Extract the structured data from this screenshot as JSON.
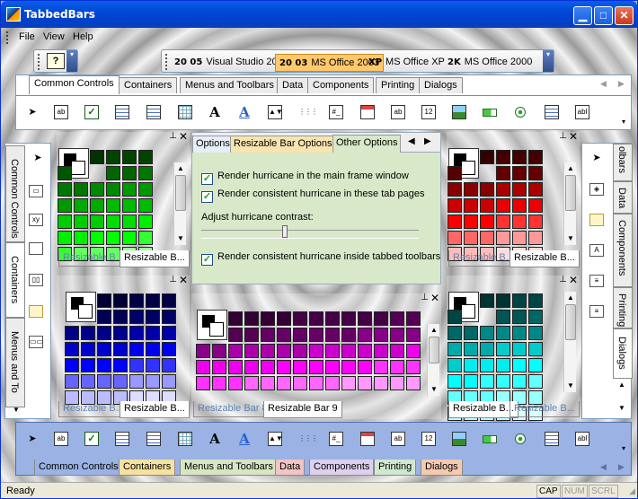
{
  "window": {
    "title": "TabbedBars"
  },
  "menu": {
    "items": [
      "File",
      "View",
      "Help"
    ]
  },
  "styles": {
    "buttons": [
      {
        "prefix": "20 05",
        "label": "Visual Studio 2005",
        "active": false
      },
      {
        "prefix": "20 03",
        "label": "MS Office 2003",
        "active": true
      },
      {
        "prefix": "XP",
        "label": "MS Office XP",
        "active": false
      },
      {
        "prefix": "2K",
        "label": "MS Office 2000",
        "active": false
      }
    ]
  },
  "top_tabs": [
    "Common Controls",
    "Containers",
    "Menus and Toolbars",
    "Data",
    "Components",
    "Printing",
    "Dialogs"
  ],
  "left_vtabs": [
    "Common Controls",
    "Containers",
    "Menus and To"
  ],
  "right_vtabs": [
    "olbars",
    "Data",
    "Components",
    "Printing",
    "Dialogs"
  ],
  "options_panel": {
    "tabs": [
      "Options",
      "Resizable Bar Options",
      "Other Options"
    ],
    "checkbox1": "Render hurricane in the main frame window",
    "checkbox2": "Render consistent hurricane in these tab pages",
    "contrast_label": "Adjust hurricane contrast:",
    "contrast_value": 0.38,
    "checkbox3": "Render consistent hurricane inside tabbed toolbars"
  },
  "bars": {
    "green": {
      "tabs": [
        "Resizable B...",
        "Resizable B..."
      ],
      "active": 1
    },
    "red": {
      "tabs": [
        "Resizable B...",
        "Resizable B..."
      ],
      "active": 1
    },
    "blue": {
      "tabs": [
        "Resizable B...",
        "Resizable B..."
      ],
      "active": 1
    },
    "magenta": {
      "tabs": [
        "Resizable Bar 8",
        "Resizable Bar 9"
      ],
      "active": 1
    },
    "cyan": {
      "tabs": [
        "Resizable B...",
        "Resizable B..."
      ],
      "active": 0
    }
  },
  "bottom_tabs": [
    {
      "label": "Common Controls",
      "color": "#9ab2e4"
    },
    {
      "label": "Containers",
      "color": "#f5e2a0"
    },
    {
      "label": "Menus and Toolbars",
      "color": "#d7e6c2"
    },
    {
      "label": "Data",
      "color": "#f2c4c4"
    },
    {
      "label": "Components",
      "color": "#dcd0ee"
    },
    {
      "label": "Printing",
      "color": "#cfe8cf"
    },
    {
      "label": "Dialogs",
      "color": "#f5c9b0"
    }
  ],
  "status": {
    "ready": "Ready",
    "cap": "CAP",
    "num": "NUM",
    "scrl": "SCRL"
  },
  "colors": {
    "green": [
      "#003300",
      "#004400",
      "#005500",
      "#006600",
      "#007700",
      "#008800",
      "#009900",
      "#00aa00",
      "#00bb00",
      "#00cc00",
      "#00dd00",
      "#00ee00",
      "#00ff00",
      "#33ff33",
      "#66ff66",
      "#99ff99"
    ],
    "red": [
      "#330000",
      "#440000",
      "#550000",
      "#660000",
      "#880000",
      "#aa0000",
      "#cc0000",
      "#ee0000",
      "#ff0000",
      "#ff3333",
      "#ff6666",
      "#ff9999",
      "#ffbbbb",
      "#ffdddd"
    ],
    "blue": [
      "#000033",
      "#000044",
      "#000055",
      "#000066",
      "#000088",
      "#0000aa",
      "#0000cc",
      "#0000ee",
      "#0000ff",
      "#3333ff",
      "#6666ff",
      "#9999ff",
      "#bbbbff",
      "#ddddff"
    ],
    "magenta": [
      "#330033",
      "#440044",
      "#550055",
      "#660066",
      "#880088",
      "#aa00aa",
      "#cc00cc",
      "#ee00ee",
      "#ff00ff",
      "#ff33ff",
      "#ff66ff",
      "#ff99ff"
    ],
    "cyan": [
      "#003333",
      "#004444",
      "#005555",
      "#006666",
      "#008888",
      "#00aaaa",
      "#00cccc",
      "#00eeee",
      "#00ffff",
      "#33ffff",
      "#66ffff",
      "#99ffff",
      "#bbffff",
      "#ddffff"
    ]
  }
}
